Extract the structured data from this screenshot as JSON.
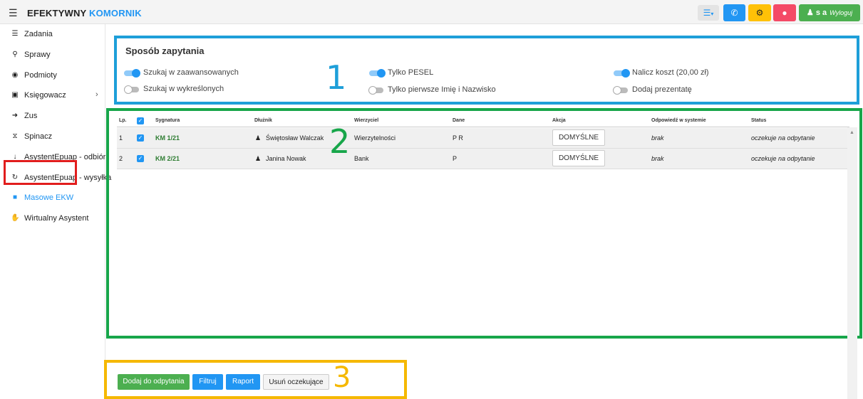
{
  "header": {
    "brand_part1": "EFEKTYWNY",
    "brand_part2": "KOMORNIK",
    "user_initials": "s a",
    "logout_label": "Wyloguj",
    "colors": {
      "brand_accent": "#2196f3",
      "phone": "#2196f3",
      "settings": "#ffc107",
      "alert": "#f44a66",
      "user": "#4caf50"
    }
  },
  "sidebar": {
    "items": [
      {
        "label": "Zadania",
        "icon": "list-icon"
      },
      {
        "label": "Sprawy",
        "icon": "search-icon"
      },
      {
        "label": "Podmioty",
        "icon": "globe-icon"
      },
      {
        "label": "Księgowacz",
        "icon": "ledger-icon",
        "has_submenu": true
      },
      {
        "label": "Zus",
        "icon": "sign-in-icon"
      },
      {
        "label": "Spinacz",
        "icon": "paperclip-icon"
      },
      {
        "label": "AsystentEpuap - odbiór",
        "icon": "arrow-down-icon"
      },
      {
        "label": "AsystentEpuap - wysyłka",
        "icon": "refresh-icon"
      },
      {
        "label": "Masowe EKW",
        "icon": "book-icon",
        "active": true
      },
      {
        "label": "Wirtualny Asystent",
        "icon": "handshake-icon"
      }
    ]
  },
  "query": {
    "title": "Sposób zapytania",
    "options": [
      {
        "label": "Szukaj w zaawansowanych",
        "on": true
      },
      {
        "label": "Szukaj w wykreślonych",
        "on": false
      },
      {
        "label": "Tylko PESEL",
        "on": true
      },
      {
        "label": "Tylko pierwsze Imię i Nazwisko",
        "on": false
      },
      {
        "label": "Nalicz koszt (20,00 zł)",
        "on": true
      },
      {
        "label": "Dodaj prezentatę",
        "on": false
      }
    ]
  },
  "table": {
    "headers": [
      "Lp.",
      "Sygnatura",
      "Dłużnik",
      "Wierzyciel",
      "Dane",
      "Akcja",
      "Odpowiedź w systemie",
      "Status"
    ],
    "rows": [
      {
        "lp": "1",
        "sygnatura": "KM 1/21",
        "dluznik": "Świętosław Walczak",
        "wierzyciel": "Wierzytelności",
        "dane": "P R",
        "akcja": "DOMYŚLNE",
        "odpowiedz": "brak",
        "status": "oczekuje na odpytanie"
      },
      {
        "lp": "2",
        "sygnatura": "KM 2/21",
        "dluznik": "Janina Nowak",
        "wierzyciel": "Bank",
        "dane": "P",
        "akcja": "DOMYŚLNE",
        "odpowiedz": "brak",
        "status": "oczekuje na odpytanie"
      }
    ]
  },
  "actions": {
    "add": "Dodaj do odpytania",
    "filter": "Filtruj",
    "report": "Raport",
    "remove": "Usuń oczekujące"
  },
  "annotations": {
    "one": "1",
    "two": "2",
    "three": "3",
    "colors": {
      "one": "#1e9fd9",
      "two": "#17a64a",
      "three": "#f5b800",
      "active_marker": "#e11d1d"
    }
  }
}
